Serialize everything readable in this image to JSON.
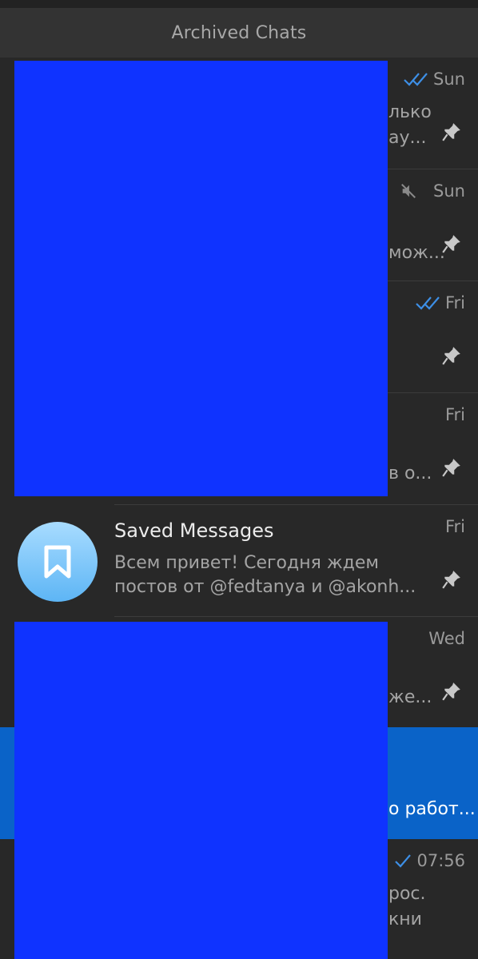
{
  "header": {
    "title": "Archived Chats"
  },
  "colors": {
    "background": "#282828",
    "header": "#333333",
    "selected": "#0a63c8",
    "redaction": "#0f33ff",
    "accent_check": "#3d8fe6"
  },
  "rows": [
    {
      "time": "Sun",
      "status_icon": "double-check-icon",
      "frag1": "лько",
      "frag2": "ау...",
      "pinned": true
    },
    {
      "time": "Sun",
      "status_icon": "muted-icon",
      "frag2": "мож...",
      "pinned": true
    },
    {
      "time": "Fri",
      "status_icon": "double-check-icon",
      "pinned": true
    },
    {
      "time": "Fri",
      "frag2": "в о...",
      "pinned": true
    },
    {
      "title": "Saved Messages",
      "time": "Fri",
      "preview_line1": "Всем привет! Сегодня ждем",
      "preview_line2": "постов от @fedtanya и @akonh...",
      "avatar_icon": "bookmark-icon",
      "pinned": true
    },
    {
      "time": "Wed",
      "frag2": "же...",
      "pinned": true
    },
    {
      "frag2": "о работ...",
      "selected": true
    },
    {
      "time": "07:56",
      "status_icon": "single-check-icon",
      "frag1": "рос.",
      "frag2": "кни"
    }
  ]
}
